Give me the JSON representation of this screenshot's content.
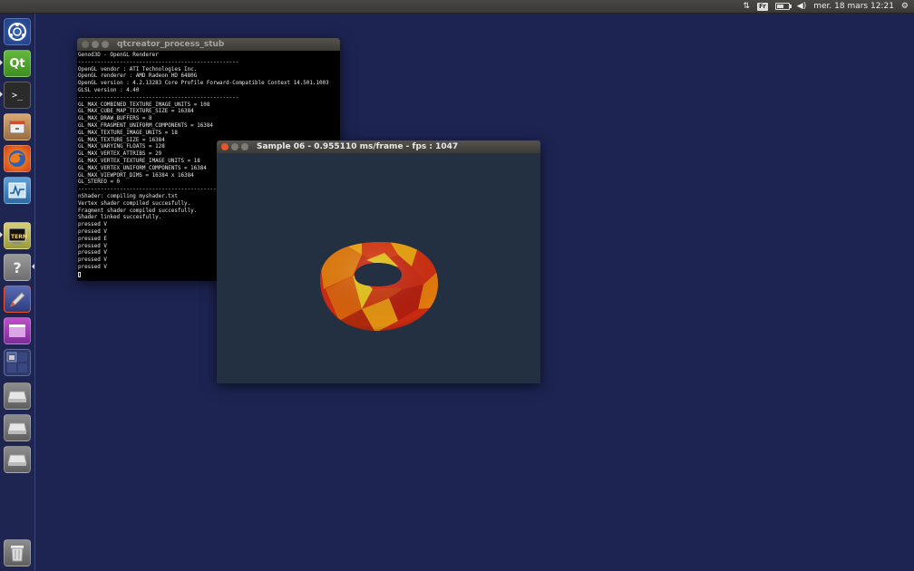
{
  "top_panel": {
    "keyboard_layout": "Fr",
    "clock": "mer. 18 mars 12:21",
    "battery_level": 0.6,
    "icons": [
      "network-icon",
      "keyboard-layout-icon",
      "battery-icon",
      "volume-icon",
      "session-gear-icon"
    ]
  },
  "launcher": {
    "items": [
      "ubuntu-dash-icon",
      "qt-creator-icon",
      "terminal-icon",
      "files-icon",
      "firefox-icon",
      "system-monitor-icon",
      "xterm-icon",
      "help-icon",
      "text-editor-icon",
      "workspace-app-icon",
      "workspace-switcher-icon",
      "drive-icon",
      "drive-icon",
      "drive-icon",
      "trash-icon"
    ]
  },
  "terminal_window": {
    "title": "qtcreator_process_stub",
    "lines": [
      "Genod3D - OpenGL Renderer",
      "--------------------------------------------------",
      "OpenGL vendor : ATI Technologies Inc.",
      "OpenGL renderer : AMD Radeon HD 6480G",
      "OpenGL version : 4.2.13283 Core Profile Forward-Compatible Context 14.501.1003",
      "GLSL version : 4.40",
      "--------------------------------------------------",
      "GL_MAX_COMBINED_TEXTURE_IMAGE_UNITS = 108",
      "GL_MAX_CUBE_MAP_TEXTURE_SIZE = 16384",
      "GL_MAX_DRAW_BUFFERS = 8",
      "GL_MAX_FRAGMENT_UNIFORM_COMPONENTS = 16384",
      "GL_MAX_TEXTURE_IMAGE_UNITS = 18",
      "GL_MAX_TEXTURE_SIZE = 16384",
      "GL_MAX_VARYING_FLOATS = 128",
      "GL_MAX_VERTEX_ATTRIBS = 29",
      "GL_MAX_VERTEX_TEXTURE_IMAGE_UNITS = 18",
      "GL_MAX_VERTEX_UNIFORM_COMPONENTS = 16384",
      "GL_MAX_VIEWPORT_DIMS = 16384 x 16384",
      "GL_STEREO = 0",
      "--------------------------------------------------",
      "nShader: compiling myshader.txt",
      "Vertex shader compiled succesfully.",
      "Fragment shader compiled succesfully.",
      "Shader linked succesfully.",
      "pressed V",
      "pressed V",
      "pressed E",
      "pressed V",
      "pressed V",
      "pressed V",
      "pressed V"
    ]
  },
  "sample_window": {
    "title": "Sample 06 - 0.955110 ms/frame - fps : 1047"
  },
  "colors": {
    "desktop": "#1d2452",
    "torus_red": "#d12a12",
    "torus_orange": "#e8820a",
    "torus_yellow": "#e3c21a",
    "close_button": "#e9542a"
  }
}
